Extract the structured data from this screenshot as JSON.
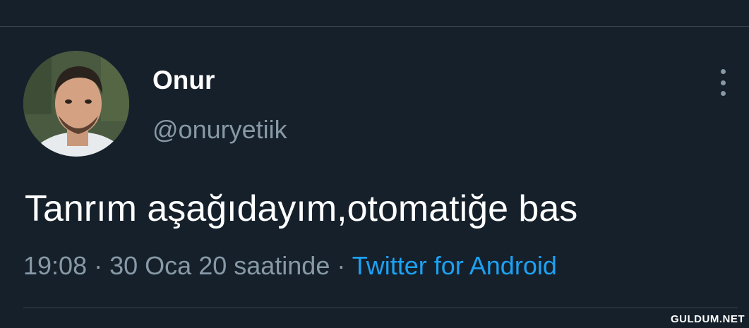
{
  "tweet": {
    "display_name": "Onur",
    "handle": "@onuryetiik",
    "text": "Tanrım aşağıdayım,otomatiğe bas",
    "time": "19:08",
    "date": "30 Oca 20 saatinde",
    "separator": "·",
    "source": "Twitter for Android",
    "more_icon": "more-vertical-icon"
  },
  "watermark": "GULDUM.NET",
  "colors": {
    "background": "#15202b",
    "secondary_text": "#8899a6",
    "link": "#1da1f2",
    "divider": "#38444d"
  }
}
